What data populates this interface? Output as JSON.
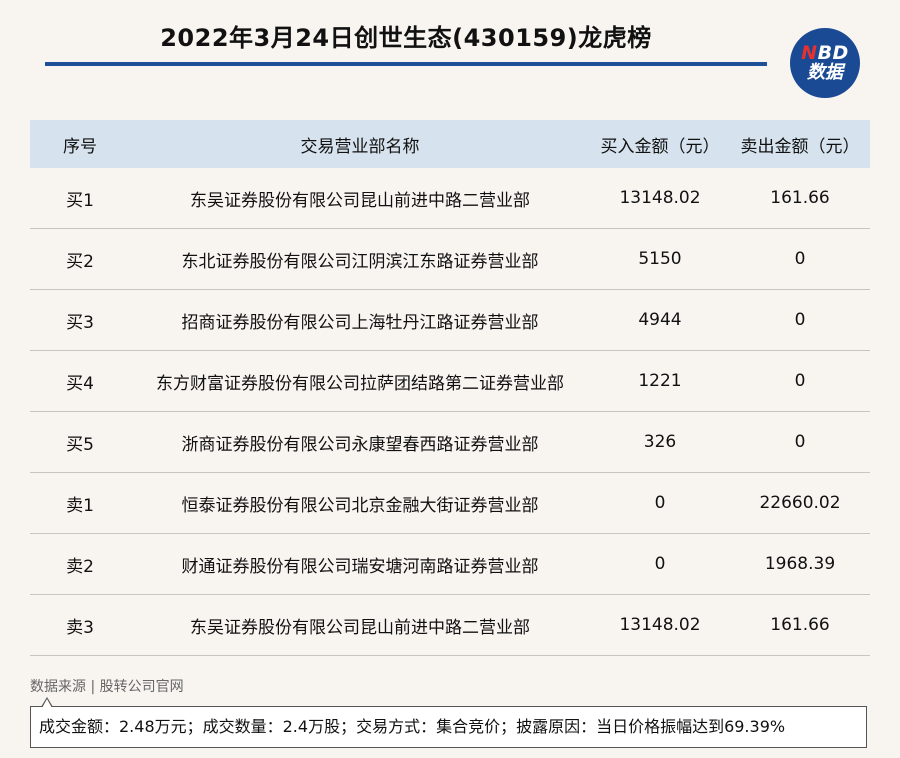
{
  "header": {
    "title": "2022年3月24日创世生态(430159)龙虎榜",
    "logo_line1_n": "N",
    "logo_line1_rest": "BD",
    "logo_line2": "数据"
  },
  "table": {
    "columns": [
      "序号",
      "交易营业部名称",
      "买入金额（元）",
      "卖出金额（元）"
    ],
    "rows": [
      {
        "seq": "买1",
        "name": "东吴证券股份有限公司昆山前进中路二营业部",
        "buy": "13148.02",
        "sell": "161.66"
      },
      {
        "seq": "买2",
        "name": "东北证券股份有限公司江阴滨江东路证券营业部",
        "buy": "5150",
        "sell": "0"
      },
      {
        "seq": "买3",
        "name": "招商证券股份有限公司上海牡丹江路证券营业部",
        "buy": "4944",
        "sell": "0"
      },
      {
        "seq": "买4",
        "name": "东方财富证券股份有限公司拉萨团结路第二证券营业部",
        "buy": "1221",
        "sell": "0"
      },
      {
        "seq": "买5",
        "name": "浙商证券股份有限公司永康望春西路证券营业部",
        "buy": "326",
        "sell": "0"
      },
      {
        "seq": "卖1",
        "name": "恒泰证券股份有限公司北京金融大街证券营业部",
        "buy": "0",
        "sell": "22660.02"
      },
      {
        "seq": "卖2",
        "name": "财通证券股份有限公司瑞安塘河南路证券营业部",
        "buy": "0",
        "sell": "1968.39"
      },
      {
        "seq": "卖3",
        "name": "东吴证券股份有限公司昆山前进中路二营业部",
        "buy": "13148.02",
        "sell": "161.66"
      }
    ]
  },
  "footer": {
    "source": "数据来源 | 股转公司官网",
    "note": "成交金额：2.48万元；成交数量：2.4万股；交易方式：集合竞价；披露原因：当日价格振幅达到69.39%"
  },
  "colors": {
    "background": "#f8f5f1",
    "accent_blue": "#1f4f96",
    "header_row": "#d6e2ed",
    "logo_red": "#e8312f"
  }
}
